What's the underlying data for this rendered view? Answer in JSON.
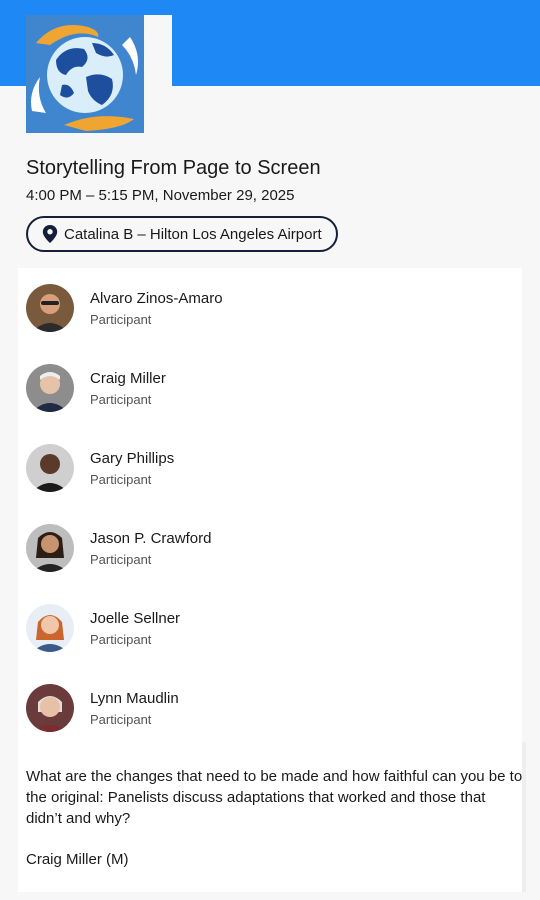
{
  "event": {
    "title": "Storytelling From Page to Screen",
    "time": "4:00 PM – 5:15 PM, November 29, 2025",
    "location": "Catalina B – Hilton Los Angeles Airport",
    "icons": {
      "location": "map-pin-icon",
      "logo": "globe-logo"
    },
    "colors": {
      "header": "#1e88f5",
      "pill_border": "#14203a"
    }
  },
  "participants": [
    {
      "name": "Alvaro Zinos-Amaro",
      "role": "Participant"
    },
    {
      "name": "Craig Miller",
      "role": "Participant"
    },
    {
      "name": "Gary Phillips",
      "role": "Participant"
    },
    {
      "name": "Jason P. Crawford",
      "role": "Participant"
    },
    {
      "name": "Joelle Sellner",
      "role": "Participant"
    },
    {
      "name": "Lynn Maudlin",
      "role": "Participant"
    }
  ],
  "description": "What are the changes that need to be made and how faithful can you be to the original: Panelists discuss adaptations that worked and those that didn’t and why?",
  "moderator": "Craig Miller (M)"
}
